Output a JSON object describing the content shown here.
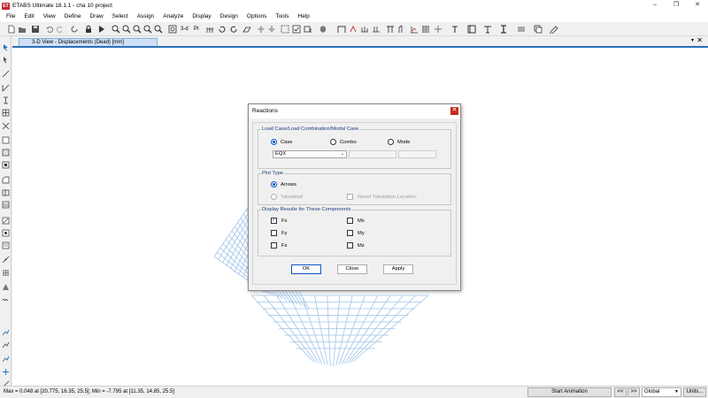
{
  "app": {
    "title": "ETABS Ultimate 18.1.1 - cha 10 project",
    "icon_text": "ET",
    "window_controls": [
      "–",
      "❐",
      "✕"
    ]
  },
  "menu": [
    "File",
    "Edit",
    "View",
    "Define",
    "Draw",
    "Select",
    "Assign",
    "Analyze",
    "Display",
    "Design",
    "Options",
    "Tools",
    "Help"
  ],
  "toolbar": {
    "icons": [
      "new-file-icon",
      "open-file-icon",
      "save-icon",
      "undo-icon",
      "redo-icon",
      "lock-icon",
      "run-analysis-icon",
      "refresh-icon",
      "zoom-in-icon",
      "zoom-out-icon",
      "zoom-window-icon",
      "pan-icon",
      "3d-view-icon",
      "plan-view-icon",
      "elevation-view-icon",
      "rotate-icon",
      "perspective-icon",
      "move-up-icon",
      "move-down-icon",
      "select-icon",
      "display-options-icon",
      "set-view-icon",
      "object-shrink-icon",
      "draw-icon",
      "reactions-icon",
      "frame-forces-icon",
      "deformed-shape-icon",
      "grid-icon",
      "snap-icon",
      "text-icon",
      "section-icon",
      "dimension-icon",
      "color-icon",
      "line-style-icon"
    ],
    "text_buttons": {
      "view_3d": "3-d",
      "plan": "PI"
    }
  },
  "view": {
    "tab_label": "3-D View  - Displacements (Dead)  [mm]",
    "pin_label": "▾",
    "close_label": "✕",
    "grid_color": "#9fc5ea"
  },
  "dialog": {
    "title": "Reactions",
    "close_label": "✕",
    "load_case_group": {
      "label": "Load Case/Load Combination/Modal Case",
      "options": [
        {
          "label": "Case",
          "selected": true
        },
        {
          "label": "Combo",
          "selected": false
        },
        {
          "label": "Mode",
          "selected": false
        }
      ],
      "case_value": "EQX",
      "combo_value": "",
      "mode_value": ""
    },
    "plot_type_group": {
      "label": "Plot Type",
      "arrows_label": "Arrows",
      "arrows_selected": true,
      "tabulated_label": "Tabulated",
      "reset_label": "Reset Tabulation Location"
    },
    "components_group": {
      "label": "Display Results for These Components",
      "items": [
        {
          "label": "Fx",
          "checked": true
        },
        {
          "label": "Mx",
          "checked": false
        },
        {
          "label": "Fy",
          "checked": false
        },
        {
          "label": "My",
          "checked": false
        },
        {
          "label": "Fz",
          "checked": false
        },
        {
          "label": "Mz",
          "checked": false
        }
      ]
    },
    "buttons": {
      "ok": "OK",
      "close": "Close",
      "apply": "Apply"
    }
  },
  "status": {
    "text": "Max = 0.048 at [20.775, 16.35, 25.5];  Min = -7.795 at [11.35, 14.85, 25.5]",
    "animation_button": "Start Animation",
    "prev": "<<",
    "next": ">>",
    "coord_system": "Global",
    "units_button": "Units..."
  }
}
